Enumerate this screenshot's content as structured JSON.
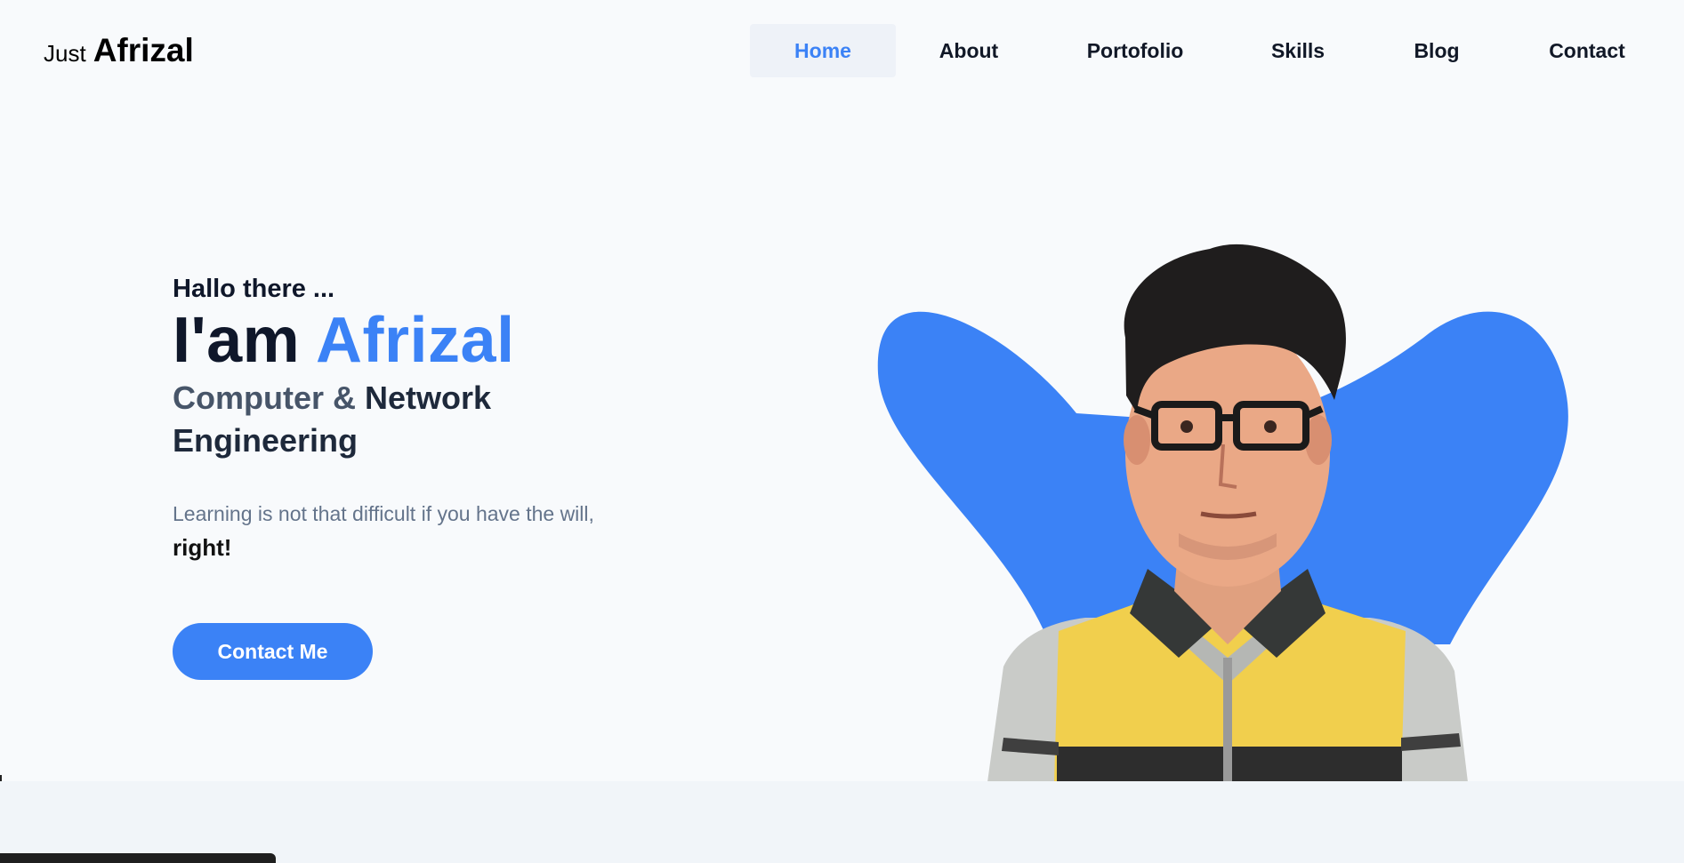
{
  "logo": {
    "prefix": "Just",
    "name": "Afrizal"
  },
  "nav": {
    "items": [
      {
        "label": "Home",
        "active": true
      },
      {
        "label": "About"
      },
      {
        "label": "Portofolio"
      },
      {
        "label": "Skills"
      },
      {
        "label": "Blog"
      },
      {
        "label": "Contact"
      }
    ]
  },
  "hero": {
    "greeting": "Hallo there ...",
    "headline_prefix": "I'am",
    "headline_name": "Afrizal",
    "role_part1": "Computer &",
    "role_part2": "Network Engineering",
    "tagline": "Learning is not that difficult if you have the will,",
    "tagline_emphasis": "right!",
    "cta_label": "Contact Me"
  },
  "colors": {
    "accent": "#3b82f6",
    "background": "#f8fafc",
    "text_dark": "#0f172a",
    "text_muted": "#64748b"
  }
}
